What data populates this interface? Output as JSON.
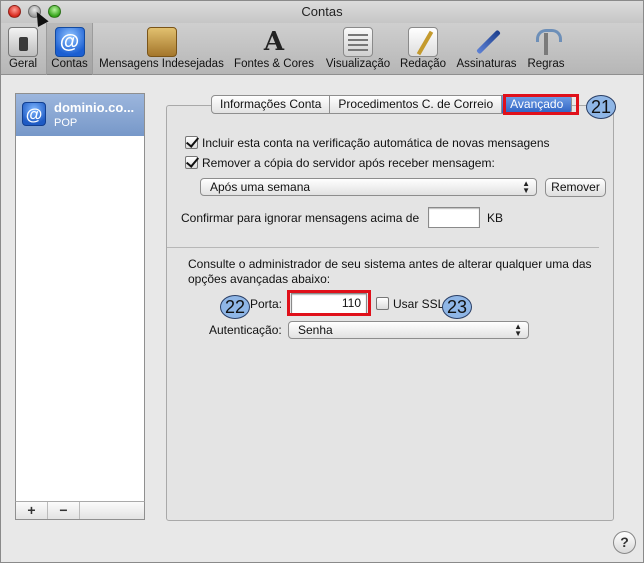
{
  "window": {
    "title": "Contas"
  },
  "toolbar": {
    "items": [
      {
        "label": "Geral",
        "icon": "switch-icon"
      },
      {
        "label": "Contas",
        "icon": "at-icon",
        "glyph": "@"
      },
      {
        "label": "Mensagens Indesejadas",
        "icon": "junk-mail-icon"
      },
      {
        "label": "Fontes & Cores",
        "icon": "fonts-colors-icon",
        "glyph": "A"
      },
      {
        "label": "Visualização",
        "icon": "viewing-icon"
      },
      {
        "label": "Redação",
        "icon": "composing-icon"
      },
      {
        "label": "Assinaturas",
        "icon": "signatures-icon"
      },
      {
        "label": "Regras",
        "icon": "rules-icon"
      }
    ]
  },
  "accounts": {
    "items": [
      {
        "name": "dominio.co...",
        "type": "POP",
        "glyph": "@"
      }
    ],
    "add_label": "+",
    "remove_label": "−"
  },
  "tabs": [
    {
      "label": "Informações Conta"
    },
    {
      "label": "Procedimentos C. de Correio"
    },
    {
      "label": "Avançado"
    }
  ],
  "advanced": {
    "include_check_label": "Incluir esta conta na verificação automática de novas mensagens",
    "remove_copy_label": "Remover a cópia do servidor após receber mensagem:",
    "remove_after_option": "Após uma semana",
    "remove_button": "Remover",
    "confirm_label": "Confirmar para ignorar mensagens acima de",
    "confirm_size_value": "",
    "size_unit": "KB",
    "admin_note_line1": "Consulte o administrador de seu sistema antes de alterar qualquer uma das",
    "admin_note_line2": "opções avançadas abaixo:",
    "port_label": "Porta:",
    "port_value": "110",
    "ssl_label": "Usar SSL",
    "auth_label": "Autenticação:",
    "auth_value": "Senha"
  },
  "annotations": {
    "badge_21": "21",
    "badge_22": "22",
    "badge_23": "23"
  },
  "help": {
    "label": "?"
  },
  "colors": {
    "highlight": "#e0101a",
    "selection": "#3a6bc8",
    "badge_fill": "#8fb6e6"
  }
}
